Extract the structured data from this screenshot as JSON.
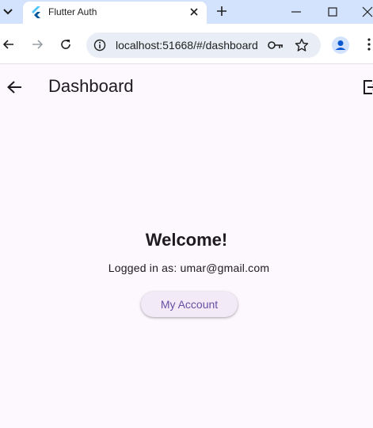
{
  "browser": {
    "tab_title": "Flutter Auth",
    "url": "localhost:51668/#/dashboard"
  },
  "appbar": {
    "title": "Dashboard"
  },
  "main": {
    "welcome": "Welcome!",
    "logged_in_text": "Logged in as: umar@gmail.com",
    "account_button": "My Account"
  },
  "colors": {
    "background": "#fdf7fe",
    "tabstrip": "#d3e3fd",
    "primary": "#6750a4",
    "button_bg": "#f2ebf7"
  },
  "icons": [
    "tab-dropdown-icon",
    "flutter-logo-icon",
    "close-icon",
    "plus-icon",
    "minimize-icon",
    "maximize-icon",
    "window-close-icon",
    "back-arrow-icon",
    "forward-arrow-icon",
    "reload-icon",
    "info-icon",
    "key-icon",
    "star-icon",
    "profile-icon",
    "kebab-menu-icon",
    "logout-icon"
  ]
}
